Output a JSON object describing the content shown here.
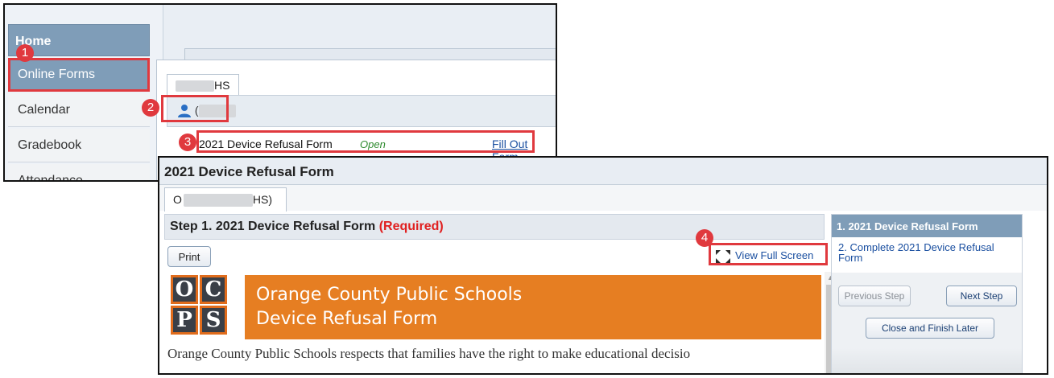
{
  "sidebar": {
    "items": [
      {
        "label": "Home"
      },
      {
        "label": "Online Forms"
      },
      {
        "label": "Calendar"
      },
      {
        "label": "Gradebook"
      },
      {
        "label": "Attendance"
      }
    ]
  },
  "forms_list": {
    "school_tab": "HS",
    "student_initial": "(",
    "form_name": "2021 Device Refusal Form",
    "form_status": "Open",
    "fill_link": "Fill Out Form"
  },
  "form_window": {
    "title": "2021 Device Refusal Form",
    "school_tab_prefix": "O",
    "school_tab_suffix": "HS)",
    "step_title": "Step 1. 2021 Device Refusal Form",
    "step_required": "(Required)",
    "print_label": "Print",
    "fullscreen_label": "View Full Screen",
    "document": {
      "logo_letters": [
        "O",
        "C",
        "P",
        "S"
      ],
      "banner_line1": "Orange County Public Schools",
      "banner_line2": "Device Refusal Form",
      "body_text": "Orange County Public Schools respects that families have the right to make educational decisio"
    },
    "steps": [
      {
        "label": "1. 2021 Device Refusal Form"
      },
      {
        "label": "2. Complete 2021 Device Refusal Form"
      }
    ],
    "buttons": {
      "previous": "Previous Step",
      "next": "Next Step",
      "close": "Close and Finish Later"
    }
  },
  "callouts": [
    "1",
    "2",
    "3",
    "4"
  ],
  "colors": {
    "highlight": "#e0393e",
    "accent_blue": "#7f9db8",
    "banner_orange": "#e67e22",
    "required_red": "#e02020",
    "status_green": "#2d8a2d",
    "link_blue": "#1a4fa0"
  }
}
